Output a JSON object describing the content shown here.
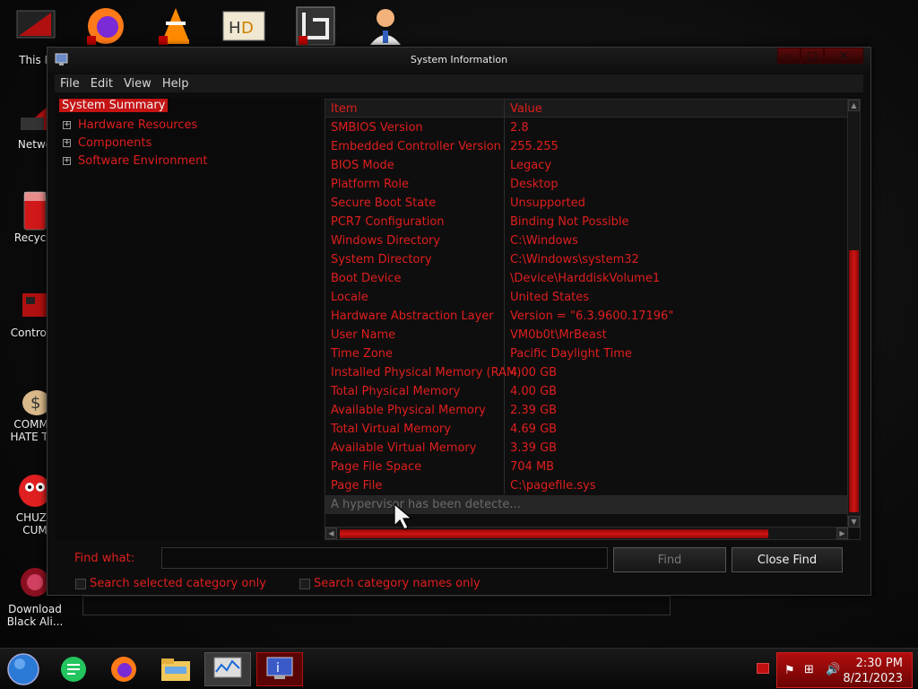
{
  "desktop": {
    "icons": [
      {
        "label": "This P"
      },
      {
        "label": "Netwo"
      },
      {
        "label": "Recycle"
      },
      {
        "label": "Control P"
      },
      {
        "label": "COMMU",
        "label2": "HATE THI"
      },
      {
        "label": "CHUZZ",
        "label2": "CUM"
      },
      {
        "label": "Download",
        "label2": "Black Ali..."
      }
    ]
  },
  "window": {
    "title": "System Information",
    "menu": [
      "File",
      "Edit",
      "View",
      "Help"
    ],
    "tree": {
      "selected": "System Summary",
      "children": [
        "Hardware Resources",
        "Components",
        "Software Environment"
      ]
    },
    "list": {
      "headers": [
        "Item",
        "Value"
      ],
      "rows": [
        {
          "item": "SMBIOS Version",
          "value": "2.8"
        },
        {
          "item": "Embedded Controller Version",
          "value": "255.255"
        },
        {
          "item": "BIOS Mode",
          "value": "Legacy"
        },
        {
          "item": "Platform Role",
          "value": "Desktop"
        },
        {
          "item": "Secure Boot State",
          "value": "Unsupported"
        },
        {
          "item": "PCR7 Configuration",
          "value": "Binding Not Possible"
        },
        {
          "item": "Windows Directory",
          "value": "C:\\Windows"
        },
        {
          "item": "System Directory",
          "value": "C:\\Windows\\system32"
        },
        {
          "item": "Boot Device",
          "value": "\\Device\\HarddiskVolume1"
        },
        {
          "item": "Locale",
          "value": "United States"
        },
        {
          "item": "Hardware Abstraction Layer",
          "value": "Version = \"6.3.9600.17196\""
        },
        {
          "item": "User Name",
          "value": "VM0b0t\\MrBeast"
        },
        {
          "item": "Time Zone",
          "value": "Pacific Daylight Time"
        },
        {
          "item": "Installed Physical Memory (RAM)",
          "value": "4.00 GB"
        },
        {
          "item": "Total Physical Memory",
          "value": "4.00 GB"
        },
        {
          "item": "Available Physical Memory",
          "value": "2.39 GB"
        },
        {
          "item": "Total Virtual Memory",
          "value": "4.69 GB"
        },
        {
          "item": "Available Virtual Memory",
          "value": "3.39 GB"
        },
        {
          "item": "Page File Space",
          "value": "704 MB"
        },
        {
          "item": "Page File",
          "value": "C:\\pagefile.sys"
        }
      ],
      "status_row": "A hypervisor has been detecte..."
    },
    "find": {
      "label": "Find what:",
      "value": "",
      "find_button": "Find",
      "close_button": "Close Find",
      "check1": "Search selected category only",
      "check2": "Search category names only"
    }
  },
  "taskbar": {
    "time": "2:30 PM",
    "date": "8/21/2023"
  },
  "colors": {
    "accent": "#e01e1e",
    "window_bg": "#0d0d0d"
  }
}
